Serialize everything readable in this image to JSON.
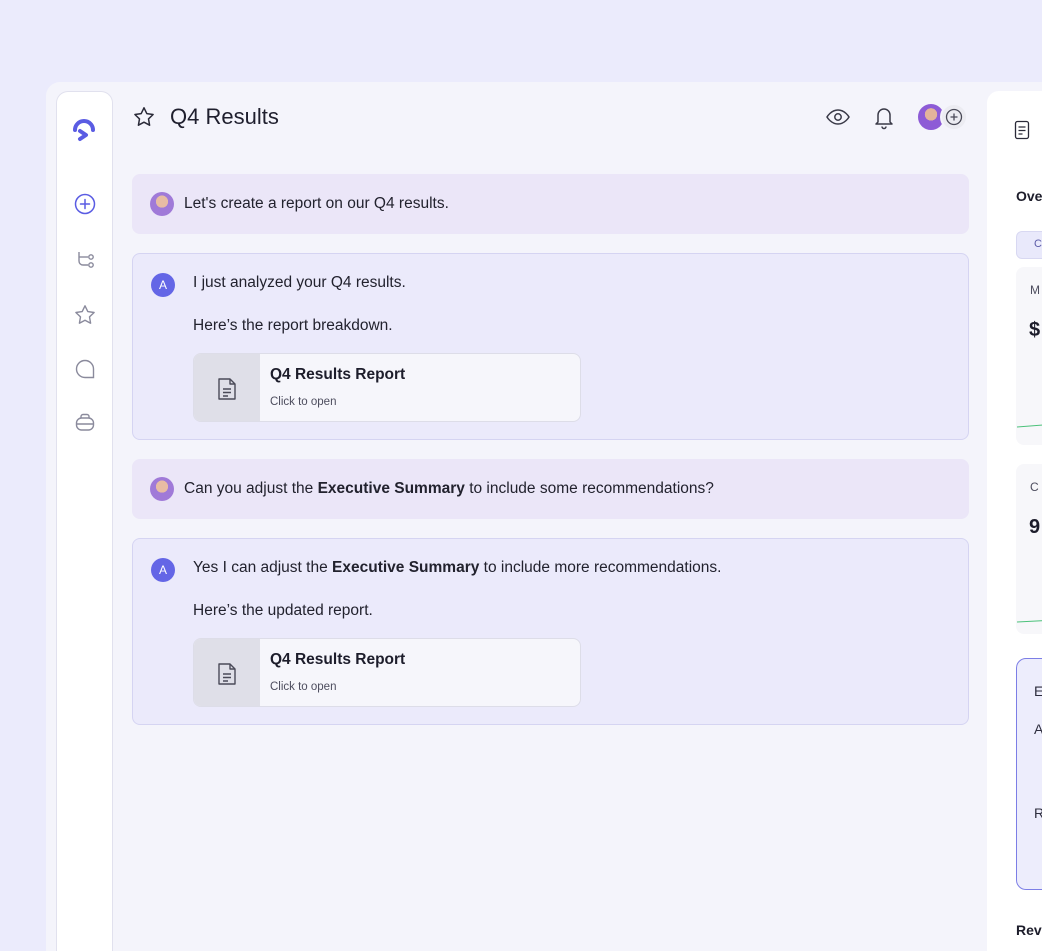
{
  "header": {
    "title": "Q4 Results"
  },
  "rail": {
    "items": [
      "new-chat",
      "workflows",
      "favorites",
      "chats",
      "toolbox"
    ]
  },
  "conversation": [
    {
      "role": "user",
      "text_before": "Let's create a report on our Q4 results.",
      "bold": "",
      "text_after": ""
    },
    {
      "role": "assistant",
      "badge": "A",
      "line1_before": "I just analyzed your Q4 results.",
      "line1_bold": "",
      "line1_after": "",
      "line2": "Here’s the report breakdown.",
      "file_title": "Q4 Results Report",
      "file_sub": "Click to open"
    },
    {
      "role": "user",
      "text_before": "Can you adjust the ",
      "bold": "Executive Summary",
      "text_after": " to include some recommendations?"
    },
    {
      "role": "assistant",
      "badge": "A",
      "line1_before": "Yes I can adjust the ",
      "line1_bold": "Executive Summary",
      "line1_after": " to include more recommendations.",
      "line2": "Here’s the updated report.",
      "file_title": "Q4 Results Report",
      "file_sub": "Click to open"
    }
  ],
  "right_panel": {
    "section_title": "Ove",
    "chip": "C",
    "card1_label": "M",
    "card1_value": "$",
    "card2_label": "C",
    "card2_value": "9",
    "exec_lines": [
      "E",
      "A",
      "R"
    ],
    "footer_title": "Rev"
  },
  "colors": {
    "accent": "#6466e6",
    "background": "#ebebfc",
    "user_bubble": "#ebe6f8",
    "assistant_bubble": "#ebeafb"
  }
}
